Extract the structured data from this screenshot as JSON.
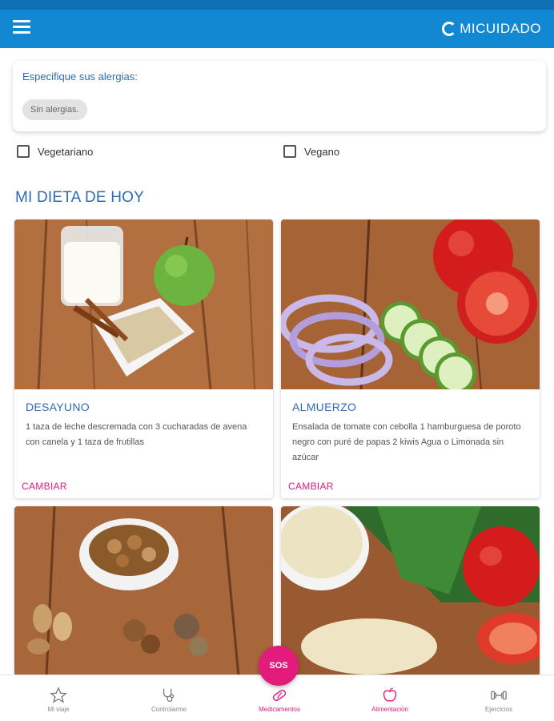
{
  "header": {
    "brand": "MICUIDADO",
    "menu_icon": "hamburger-menu-icon",
    "color": "#1288d3"
  },
  "allergies": {
    "label": "Especifique sus alergias:",
    "chip": "Sin alergias."
  },
  "diet_options": [
    {
      "label": "Vegetariano",
      "checked": false
    },
    {
      "label": "Vegano",
      "checked": false
    }
  ],
  "section": {
    "title": "MI DIETA DE HOY"
  },
  "meals": [
    {
      "title": "DESAYUNO",
      "description": "1 taza de leche descremada con 3 cucharadas de avena con canela y 1 taza de frutillas",
      "action": "CAMBIAR"
    },
    {
      "title": "ALMUERZO",
      "description": "Ensalada de tomate con cebolla 1 hamburguesa de poroto negro con puré de papas 2 kiwis Agua o Limonada sin azúcar",
      "action": "CAMBIAR"
    }
  ],
  "sos": {
    "label": "SOS",
    "color": "#e31c7c"
  },
  "bottom_nav": [
    {
      "label": "Mi viaje",
      "icon": "star-icon"
    },
    {
      "label": "Controlarme",
      "icon": "stethoscope-icon"
    },
    {
      "label": "Medicamentos",
      "icon": "pill-icon"
    },
    {
      "label": "Alimentación",
      "icon": "apple-icon"
    },
    {
      "label": "Ejercicios",
      "icon": "dumbbell-icon"
    }
  ],
  "colors": {
    "accent_blue": "#2f6ab5",
    "accent_pink": "#e31c7c"
  }
}
